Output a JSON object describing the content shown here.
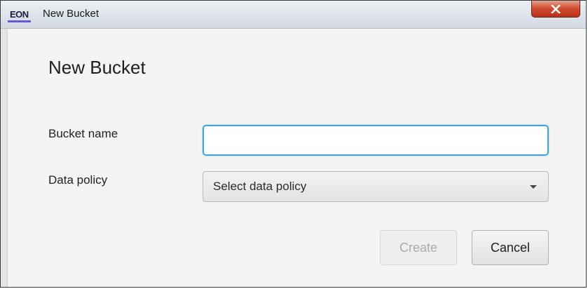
{
  "window": {
    "logo_text": "EON",
    "title": "New Bucket",
    "close_icon": "close-icon"
  },
  "dialog": {
    "heading": "New Bucket",
    "bucket_name_label": "Bucket name",
    "bucket_name_value": "",
    "data_policy_label": "Data policy",
    "data_policy_placeholder": "Select data policy",
    "create_button": "Create",
    "cancel_button": "Cancel"
  },
  "colors": {
    "accent_focus": "#3fa5d8",
    "close_button": "#cf4a2e",
    "disabled_text": "#aaaaaa"
  }
}
